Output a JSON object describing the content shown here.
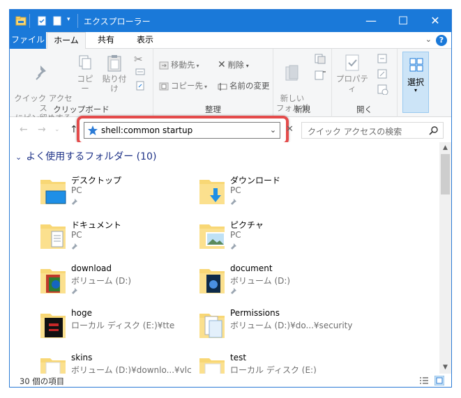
{
  "window": {
    "title": "エクスプローラー",
    "accent": "#1a79d9",
    "minimize": "—",
    "maximize": "☐",
    "close": "✕"
  },
  "ribbon_tabs": [
    "ファイル",
    "ホーム",
    "共有",
    "表示"
  ],
  "ribbon": {
    "clipboard": {
      "pin_label": "クイック アクセス\nにピン留めする",
      "copy_label": "コピー",
      "paste_label": "貼り付け",
      "group_label": "クリップボード"
    },
    "organize": {
      "move_to": "移動先",
      "copy_to": "コピー先",
      "delete": "削除",
      "rename": "名前の変更",
      "group_label": "整理"
    },
    "new": {
      "new_folder": "新しい\nフォルダー",
      "group_label": "新規"
    },
    "open": {
      "properties": "プロパティ",
      "group_label": "開く"
    },
    "select": {
      "label": "選択"
    }
  },
  "address": {
    "value": "shell:common startup",
    "highlight_color": "#e44b4b"
  },
  "search": {
    "placeholder": "クイック アクセスの検索"
  },
  "section": {
    "title": "よく使用するフォルダー (10)"
  },
  "items": [
    {
      "name": "デスクトップ",
      "sub": "PC",
      "icon": "desktop-folder-icon",
      "pinned": true
    },
    {
      "name": "ダウンロード",
      "sub": "PC",
      "icon": "downloads-folder-icon",
      "pinned": true
    },
    {
      "name": "ドキュメント",
      "sub": "PC",
      "icon": "documents-folder-icon",
      "pinned": true
    },
    {
      "name": "ピクチャ",
      "sub": "PC",
      "icon": "pictures-folder-icon",
      "pinned": true
    },
    {
      "name": "download",
      "sub": "ボリューム (D:)",
      "icon": "folder-icon",
      "pinned": true
    },
    {
      "name": "document",
      "sub": "ボリューム (D:)",
      "icon": "folder-icon",
      "pinned": true
    },
    {
      "name": "hoge",
      "sub": "ローカル ディスク (E:)¥tte",
      "icon": "folder-icon",
      "pinned": false
    },
    {
      "name": "Permissions",
      "sub": "ボリューム (D:)¥do...¥security",
      "icon": "folder-icon",
      "pinned": false
    },
    {
      "name": "skins",
      "sub": "ボリューム (D:)¥downlo...¥vlc",
      "icon": "folder-icon",
      "pinned": false
    },
    {
      "name": "test",
      "sub": "ローカル ディスク (E:)",
      "icon": "folder-icon",
      "pinned": false
    }
  ],
  "status": {
    "count": "30 個の項目"
  }
}
